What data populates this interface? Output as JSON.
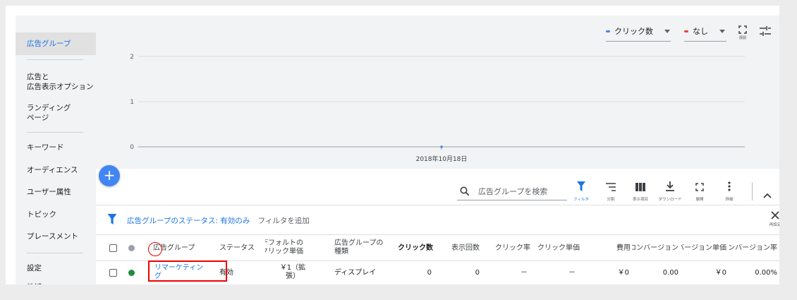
{
  "sidebar": {
    "items": [
      {
        "label": "広告グループ",
        "active": true
      },
      {
        "label": "広告と\n広告表示オプション"
      },
      {
        "label": "ランディング\nページ"
      },
      {
        "label": "キーワード"
      },
      {
        "label": "オーディエンス"
      },
      {
        "label": "ユーザー属性"
      },
      {
        "label": "トピック"
      },
      {
        "label": "プレースメント"
      },
      {
        "label": "設定"
      },
      {
        "label": "地域"
      }
    ]
  },
  "chart": {
    "metric1_label": "クリック数",
    "metric1_color": "#4285f4",
    "metric2_label": "なし",
    "metric2_color": "#ea4335",
    "expand_label": "展開",
    "y_ticks": [
      "2",
      "1",
      "0"
    ],
    "x_label": "2018年10月18日"
  },
  "chart_data": {
    "type": "line",
    "x": [
      "2018年10月18日"
    ],
    "series": [
      {
        "name": "クリック数",
        "values": [
          0
        ]
      }
    ],
    "ylim": [
      0,
      2
    ]
  },
  "toolbar": {
    "search_placeholder": "広告グループを検索",
    "tools": [
      {
        "label": "フィルタ",
        "icon": "filter-icon"
      },
      {
        "label": "分割",
        "icon": "segment-icon"
      },
      {
        "label": "表示項目",
        "icon": "columns-icon"
      },
      {
        "label": "ダウンロード",
        "icon": "download-icon"
      },
      {
        "label": "展開",
        "icon": "expand-icon"
      },
      {
        "label": "詳細",
        "icon": "more-icon"
      }
    ]
  },
  "filter": {
    "status_text": "広告グループのステータス: 有効のみ",
    "add_filter": "フィルタを追加",
    "reset_label": "再設定"
  },
  "table": {
    "headers": {
      "name": "広告グループ",
      "status": "ステータス",
      "cpc_bid": "デフォルトの\nクリック単価",
      "type": "広告グループの\n種類",
      "clicks": "クリック数",
      "impressions": "表示回数",
      "ctr": "クリック率",
      "avg_cpc": "クリック単価",
      "cost": "費用",
      "conversions": "コンバージョン",
      "cost_per_conv": "コンバージョン単価",
      "conv_rate": "コンバージョン率"
    },
    "rows": [
      {
        "name": "リマーケティング",
        "status": "有効",
        "cpc_bid": "￥1（拡張）",
        "type": "ディスプレイ",
        "clicks": "0",
        "impressions": "0",
        "ctr": "－",
        "avg_cpc": "－",
        "cost": "￥0",
        "conversions": "0.00",
        "cost_per_conv": "￥0",
        "conv_rate": "0.00%"
      }
    ]
  }
}
